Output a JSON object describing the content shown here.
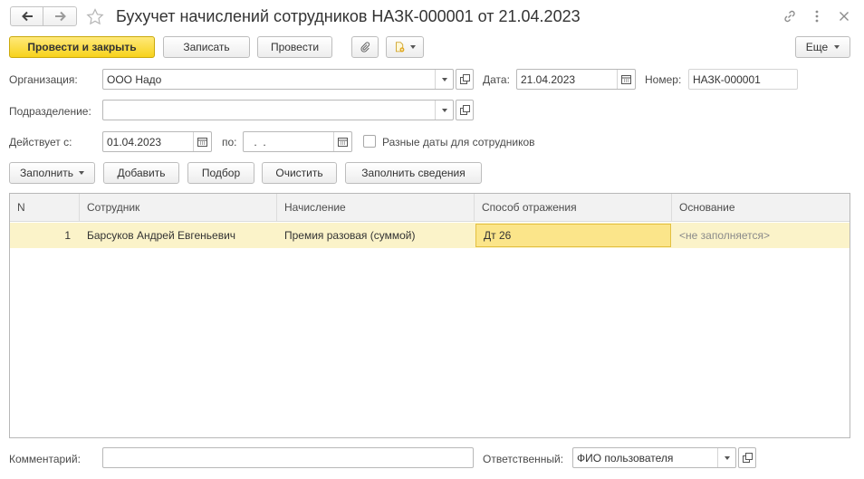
{
  "window": {
    "title": "Бухучет начислений сотрудников НАЗК-000001 от 21.04.2023",
    "icons": [
      "arrow-left-icon",
      "arrow-right-icon",
      "star-icon",
      "link-icon",
      "more-vertical-icon",
      "close-icon"
    ]
  },
  "toolbar": {
    "post_close": "Провести и закрыть",
    "save": "Записать",
    "post": "Провести",
    "more": "Еще"
  },
  "form": {
    "org_label": "Организация:",
    "org_value": "ООО Надо",
    "date_label": "Дата:",
    "date_value": "21.04.2023",
    "number_label": "Номер:",
    "number_value": "НАЗК-000001",
    "dept_label": "Подразделение:",
    "dept_value": "",
    "valid_from_label": "Действует с:",
    "valid_from_value": "01.04.2023",
    "to_label": "по:",
    "to_value": " .  .",
    "diff_dates_label": "Разные даты для сотрудников",
    "diff_dates_checked": false
  },
  "table_toolbar": {
    "fill": "Заполнить",
    "add": "Добавить",
    "select": "Подбор",
    "clear": "Очистить",
    "fill_info": "Заполнить сведения"
  },
  "table": {
    "columns": [
      "N",
      "Сотрудник",
      "Начисление",
      "Способ отражения",
      "Основание"
    ],
    "rows": [
      {
        "n": "1",
        "employee": "Барсуков Андрей Евгеньевич",
        "accrual": "Премия разовая (суммой)",
        "method": "Дт 26",
        "basis": "<не заполняется>"
      }
    ]
  },
  "footer": {
    "comment_label": "Комментарий:",
    "comment_value": "",
    "responsible_label": "Ответственный:",
    "responsible_value": "ФИО пользователя"
  },
  "colors": {
    "primary_button": "#f7d21c",
    "selected_row": "#fbf3c9",
    "active_cell": "#fbe58a"
  }
}
